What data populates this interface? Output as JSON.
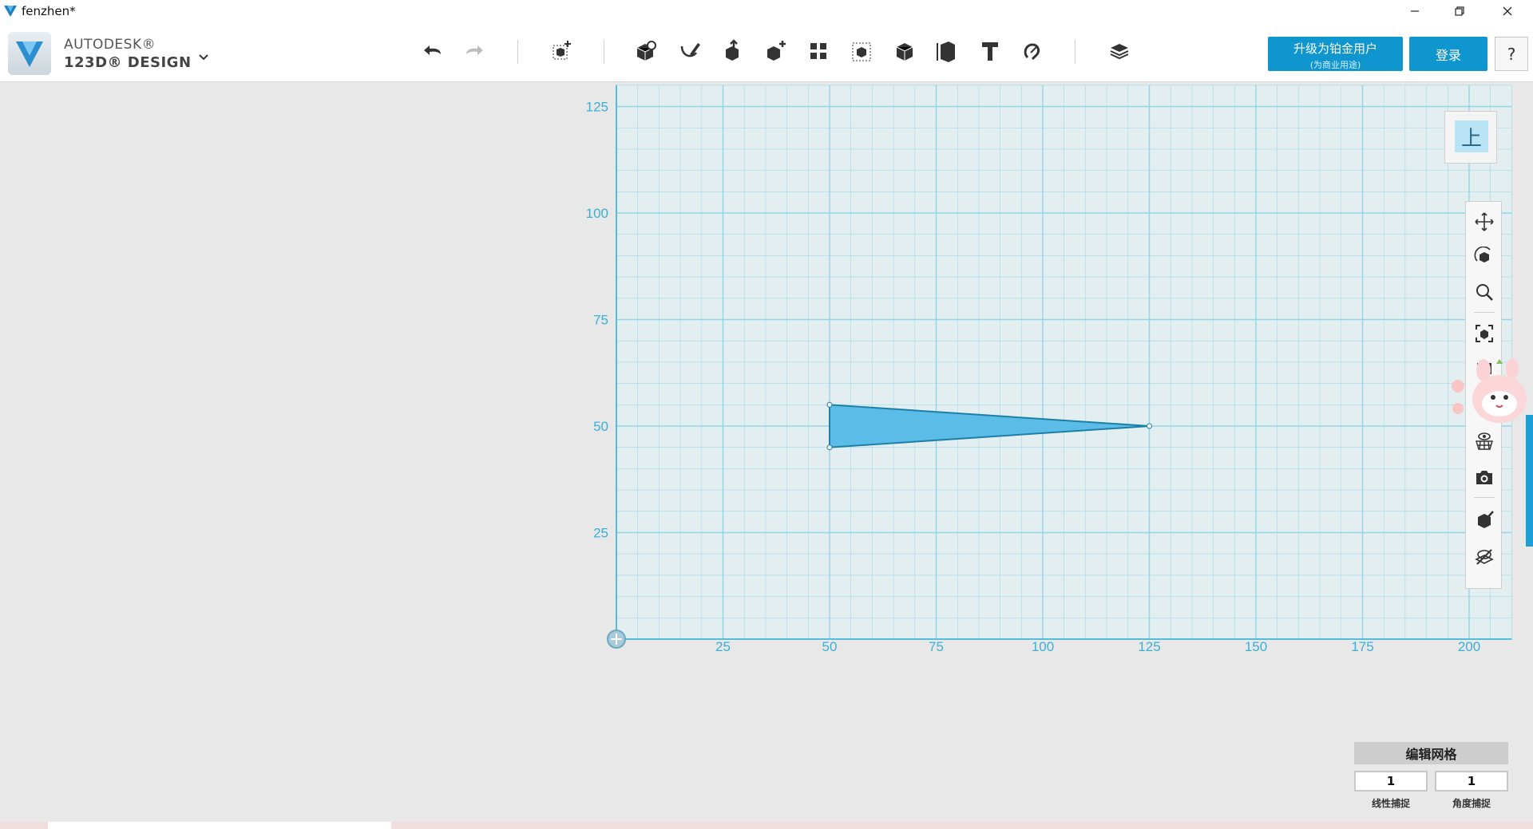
{
  "window": {
    "title": "fenzhen*"
  },
  "brand": {
    "line1": "AUTODESK®",
    "line2": "123D® DESIGN"
  },
  "toolbar": {
    "tools": [
      "undo-icon",
      "redo-icon",
      "transform-icon",
      "primitives-icon",
      "sketch-icon",
      "construct-icon",
      "modify-icon",
      "pattern-icon",
      "grouping-icon",
      "combine-icon",
      "measure-icon",
      "text-icon",
      "snap-icon",
      "material-icon"
    ],
    "upgrade_label": "升级为铂金用户",
    "upgrade_sub": "(为商业用途)",
    "login_label": "登录",
    "help_label": "?"
  },
  "viewcube": {
    "face_label": "上"
  },
  "grid": {
    "x_ticks": [
      "25",
      "50",
      "75",
      "100",
      "125",
      "150",
      "175",
      "200"
    ],
    "y_ticks": [
      "125",
      "100",
      "75",
      "50",
      "25"
    ],
    "x_range": [
      0,
      210
    ],
    "y_range": [
      0,
      130
    ],
    "minor_step": 5,
    "major_step": 25,
    "shape_vertices": [
      [
        50,
        55
      ],
      [
        50,
        45
      ],
      [
        125,
        50
      ]
    ],
    "shape_color": "#5bbce8",
    "grid_color": "#8ed3e6",
    "label_color": "#3aafd6"
  },
  "navbar": {
    "buttons": [
      "pan-icon",
      "orbit-icon",
      "zoom-icon",
      "fit-icon",
      "view-options-icon",
      "grid-visibility-icon",
      "camera-icon",
      "materials-shading-icon",
      "visibility-icon"
    ]
  },
  "grid_panel": {
    "title": "编辑网格",
    "linear_snap_value": "1",
    "angle_snap_value": "1",
    "linear_snap_label": "线性捕捉",
    "angle_snap_label": "角度捕捉"
  }
}
